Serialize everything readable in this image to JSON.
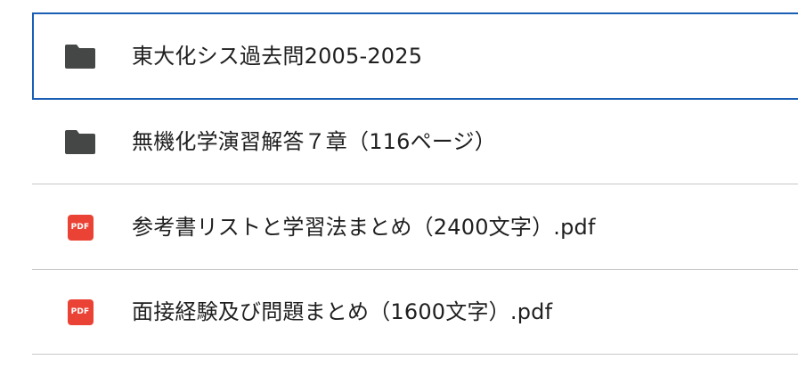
{
  "colors": {
    "folder_icon": "#444746",
    "pdf_icon": "#ea4335",
    "selection_border": "#1a5fb4",
    "divider": "#c7c7c7",
    "text": "#1f1f1f"
  },
  "files": [
    {
      "name": "東大化シス過去問2005-2025",
      "icon": "folder-icon",
      "selected": true
    },
    {
      "name": "無機化学演習解答７章（116ページ）",
      "icon": "folder-icon",
      "selected": false
    },
    {
      "name": "参考書リストと学習法まとめ（2400文字）.pdf",
      "icon": "pdf-icon",
      "icon_label": "PDF",
      "selected": false
    },
    {
      "name": "面接経験及び問題まとめ（1600文字）.pdf",
      "icon": "pdf-icon",
      "icon_label": "PDF",
      "selected": false
    }
  ]
}
